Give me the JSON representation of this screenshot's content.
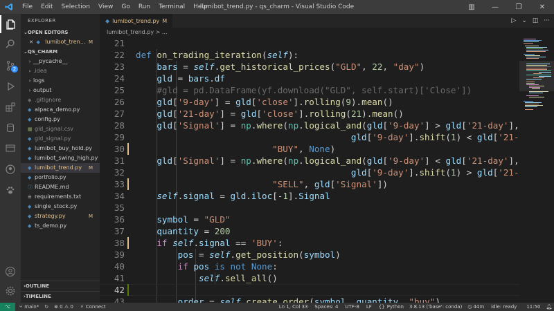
{
  "window": {
    "title": "lumibot_trend.py - qs_charm - Visual Studio Code",
    "menu": [
      "File",
      "Edit",
      "Selection",
      "View",
      "Go",
      "Run",
      "Terminal",
      "Help"
    ]
  },
  "sidebar": {
    "title": "EXPLORER",
    "open_editors_label": "OPEN EDITORS",
    "open_editor": {
      "name": "lumibot_tren...",
      "status": "M"
    },
    "workspace_label": "QS_CHARM",
    "items": [
      {
        "name": "__pycache__",
        "kind": "folder"
      },
      {
        "name": ".idea",
        "kind": "folder"
      },
      {
        "name": "logs",
        "kind": "folder"
      },
      {
        "name": "output",
        "kind": "folder"
      },
      {
        "name": ".gitignore",
        "kind": "file"
      },
      {
        "name": "alpaca_demo.py",
        "kind": "file"
      },
      {
        "name": "config.py",
        "kind": "file"
      },
      {
        "name": "gld_signal.csv",
        "kind": "file"
      },
      {
        "name": "gld_signal.py",
        "kind": "file"
      },
      {
        "name": "lumibot_buy_hold.py",
        "kind": "file"
      },
      {
        "name": "lumibot_swing_high.py",
        "kind": "file"
      },
      {
        "name": "lumibot_trend.py",
        "kind": "file",
        "status": "M"
      },
      {
        "name": "portfolio.py",
        "kind": "file"
      },
      {
        "name": "README.md",
        "kind": "file"
      },
      {
        "name": "requirements.txt",
        "kind": "file"
      },
      {
        "name": "single_stock.py",
        "kind": "file"
      },
      {
        "name": "strategy.py",
        "kind": "file",
        "status": "M"
      },
      {
        "name": "ts_demo.py",
        "kind": "file"
      }
    ],
    "outline_label": "OUTLINE",
    "timeline_label": "TIMELINE"
  },
  "tab": {
    "name": "lumibot_trend.py",
    "status": "M"
  },
  "breadcrumb": "lumibot_trend.py > ...",
  "editor": {
    "line_numbers": [
      "21",
      "22",
      "23",
      "24",
      "25",
      "26",
      "27",
      "28",
      "29",
      "30",
      "31",
      "32",
      "33",
      "34",
      "35",
      "36",
      "37",
      "38",
      "39",
      "40",
      "41",
      "42",
      "43"
    ],
    "current_line": "42"
  },
  "statusbar": {
    "branch": "main*",
    "sync": "↻",
    "problems": "⊗ 0 ⚠ 0",
    "connect": "Connect",
    "position": "Ln 1, Col 33",
    "spaces": "Spaces: 4",
    "encoding": "UTF-8",
    "eol": "LF",
    "language": "Python",
    "interpreter": "3.8.13 ('base': conda)",
    "time_spent": "44m",
    "idle": "idle: ready",
    "clock": "11:50"
  }
}
